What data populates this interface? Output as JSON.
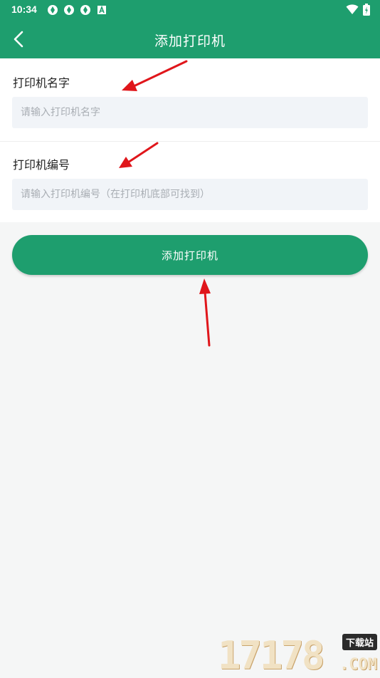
{
  "status_bar": {
    "time": "10:34",
    "left_icons": [
      "aperture-icon",
      "aperture-icon",
      "aperture-icon",
      "font-a-icon"
    ],
    "right_icons": [
      "wifi-icon",
      "battery-icon"
    ]
  },
  "app_bar": {
    "title": "添加打印机",
    "back_icon": "chevron-left-icon",
    "background": "#1e9e6e"
  },
  "form": {
    "name_field": {
      "label": "打印机名字",
      "placeholder": "请输入打印机名字",
      "value": ""
    },
    "number_field": {
      "label": "打印机编号",
      "placeholder": "请输入打印机编号（在打印机底部可找到）",
      "value": ""
    }
  },
  "submit_button": {
    "label": "添加打印机",
    "color": "#1e9e6e"
  },
  "annotations": {
    "arrow_color": "#e0161b"
  },
  "watermark": {
    "digits": "17178",
    "badge": "下载站",
    "suffix": ".COM"
  }
}
